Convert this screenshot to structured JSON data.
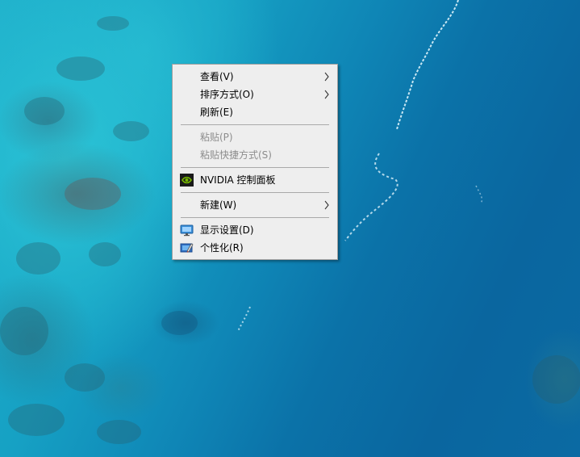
{
  "desktop": {
    "wallpaper": "aerial-reef-ocean",
    "colors": {
      "shallow": "#23b6cf",
      "deep": "#0a669f",
      "surf": "#ebfaff"
    }
  },
  "context_menu": {
    "background": "#eeeeee",
    "groups": [
      [
        {
          "label": "查看(V)",
          "submenu": true,
          "enabled": true
        },
        {
          "label": "排序方式(O)",
          "submenu": true,
          "enabled": true
        },
        {
          "label": "刷新(E)",
          "submenu": false,
          "enabled": true
        }
      ],
      [
        {
          "label": "粘贴(P)",
          "submenu": false,
          "enabled": false
        },
        {
          "label": "粘贴快捷方式(S)",
          "submenu": false,
          "enabled": false
        }
      ],
      [
        {
          "label": "NVIDIA 控制面板",
          "icon": "nvidia-icon",
          "submenu": false,
          "enabled": true
        }
      ],
      [
        {
          "label": "新建(W)",
          "submenu": true,
          "enabled": true
        }
      ],
      [
        {
          "label": "显示设置(D)",
          "icon": "display-settings-icon",
          "submenu": false,
          "enabled": true
        },
        {
          "label": "个性化(R)",
          "icon": "personalize-icon",
          "submenu": false,
          "enabled": true
        }
      ]
    ],
    "icons": {
      "submenu_arrow": "chevron-right-icon"
    }
  }
}
